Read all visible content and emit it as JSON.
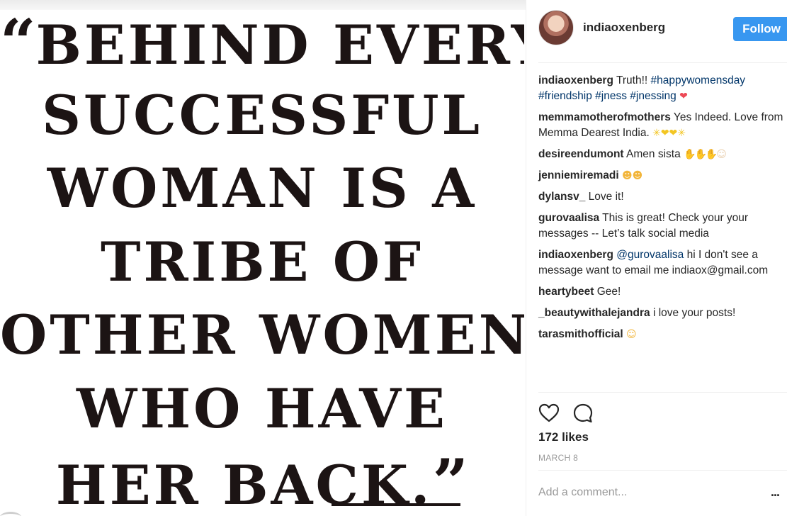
{
  "post": {
    "quote_lines": [
      "BEHIND EVERY",
      "SUCCESSFUL",
      "WOMAN IS A",
      "TRIBE OF",
      "OTHER WOMEN",
      "WHO HAVE",
      "HER BACK."
    ],
    "open_quote": "“",
    "close_quote": "”"
  },
  "header": {
    "username": "indiaoxenberg",
    "follow_label": "Follow"
  },
  "colors": {
    "follow_button": "#3897f0",
    "link": "#003569",
    "like_heart": "#ed4956",
    "muted_text": "#999999"
  },
  "comments": [
    {
      "user": "indiaoxenberg",
      "text": " Truth!! ",
      "hashtags": [
        "#happywomensday",
        "#friendship",
        "#jness",
        "#jnessing"
      ],
      "emoji": "❤"
    },
    {
      "user": "memmamotherofmothers",
      "text": " Yes Indeed. Love from Memma Dearest India. ",
      "emoji": "✳❤❤✳"
    },
    {
      "user": "desireendumont",
      "text": " Amen sista ",
      "emoji": "✋✋✋☺"
    },
    {
      "user": "jenniemiremadi",
      "text": " ",
      "emoji": "☻☻"
    },
    {
      "user": "dylansv_",
      "text": " Love it!"
    },
    {
      "user": "gurovaalisa",
      "text": " This is great! Check your your messages -- Let’s talk social media"
    },
    {
      "user": "indiaoxenberg",
      "mention": "@gurovaalisa",
      "text": " hi I don't see a message want to email me indiaox@gmail.com"
    },
    {
      "user": "heartybeet",
      "text": " Gee!"
    },
    {
      "user": "_beautywithalejandra",
      "text": " i love your posts!"
    },
    {
      "user": "tarasmithofficial",
      "text": " ",
      "emoji": "☺"
    }
  ],
  "actions": {
    "like_icon": "heart-outline-icon",
    "comment_icon": "speech-bubble-icon"
  },
  "likes_text": "172 likes",
  "date_text": "MARCH 8",
  "comment_box": {
    "placeholder": "Add a comment...",
    "more_label": "..."
  }
}
